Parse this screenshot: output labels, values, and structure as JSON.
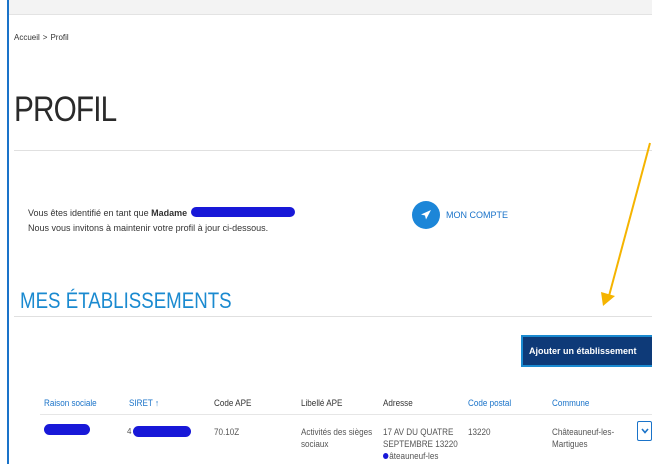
{
  "breadcrumb": {
    "home": "Accueil",
    "separator": ">",
    "current": "Profil"
  },
  "page": {
    "title": "PROFIL"
  },
  "identity": {
    "line1_prefix": "Vous êtes identifié en tant que",
    "civility": "Madame",
    "line2": "Nous vous invitons à maintenir votre profil à jour ci-dessous."
  },
  "account": {
    "label": "MON COMPTE",
    "icon": "paper-plane-icon"
  },
  "establishments": {
    "title": "MES ÉTABLISSEMENTS",
    "add_label": "Ajouter un établissement",
    "columns": [
      "Raison sociale",
      "SIRET",
      "Code APE",
      "Libellé APE",
      "Adresse",
      "Code postal",
      "Commune"
    ],
    "sort_indicator": "↑",
    "rows": [
      {
        "raison_sociale": "",
        "siret_prefix": "4",
        "code_ape": "70.10Z",
        "libelle_ape_1": "Activités des sièges",
        "libelle_ape_2": "sociaux",
        "adresse_1": "17 AV DU QUATRE",
        "adresse_2": "SEPTEMBRE 13220",
        "adresse_3": "âteauneuf-les",
        "code_postal": "13220",
        "commune_1": "Châteauneuf-les-",
        "commune_2": "Martigues"
      }
    ]
  },
  "colors": {
    "accent": "#1a8ad0",
    "button_bg": "#0e3a78",
    "redaction": "#1818d8",
    "annotation_arrow": "#f5b400"
  }
}
